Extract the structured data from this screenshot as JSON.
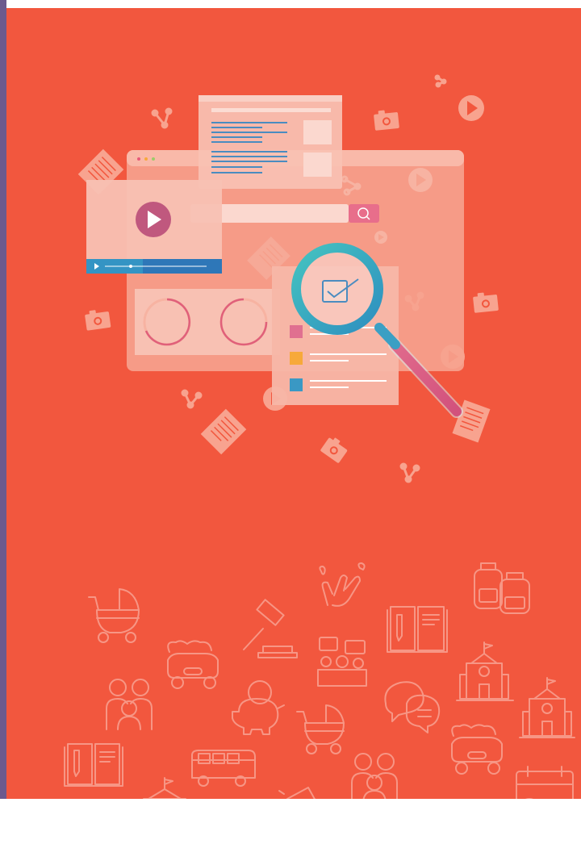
{
  "colors": {
    "coral": "#F2573E",
    "sidebar": "#6C5A8E",
    "page": "#FFFFFF",
    "panel": "#F7BDB0",
    "teal": "#3FB8C0",
    "blue": "#2E77B8",
    "pink": "#D8537C",
    "orange": "#F7A93A"
  },
  "illustration": {
    "subject": "web-search-and-media-analytics",
    "icons": [
      "play-icon",
      "camera-icon",
      "share-icon",
      "document-icon",
      "magnifier-icon",
      "checkbox-icon",
      "search-icon"
    ]
  },
  "pattern_icons": [
    "stroller-icon",
    "clapping-hands-icon",
    "backpack-icon",
    "gavel-icon",
    "book-icon",
    "school-icon",
    "car-icon",
    "family-icon",
    "piggy-bank-icon",
    "chat-icon",
    "bus-icon",
    "megaphone-icon",
    "calendar-icon",
    "meeting-icon"
  ]
}
